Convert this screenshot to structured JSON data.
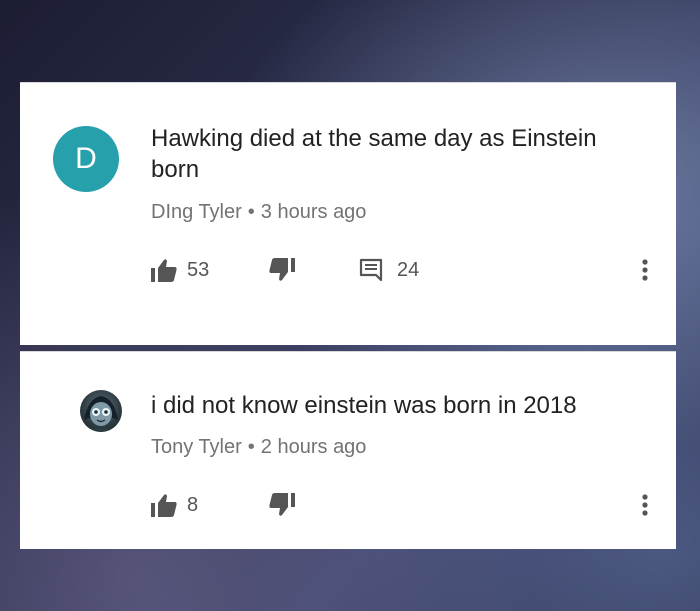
{
  "comments": [
    {
      "avatar_letter": "D",
      "avatar_color": "#26a1ac",
      "text": "Hawking died at the same day as Einstein born",
      "author": "DIng Tyler",
      "separator": "•",
      "time": "3 hours ago",
      "likes": "53",
      "replies": "24"
    },
    {
      "text": "i did not know einstein was born in 2018",
      "author": "Tony Tyler",
      "separator": "•",
      "time": "2 hours ago",
      "likes": "8"
    }
  ],
  "icons": {
    "like": "thumbs-up-icon",
    "dislike": "thumbs-down-icon",
    "reply": "comment-icon",
    "more": "more-vertical-icon"
  },
  "colors": {
    "icon": "#555555",
    "meta_text": "#737373",
    "body_text": "#222222"
  }
}
